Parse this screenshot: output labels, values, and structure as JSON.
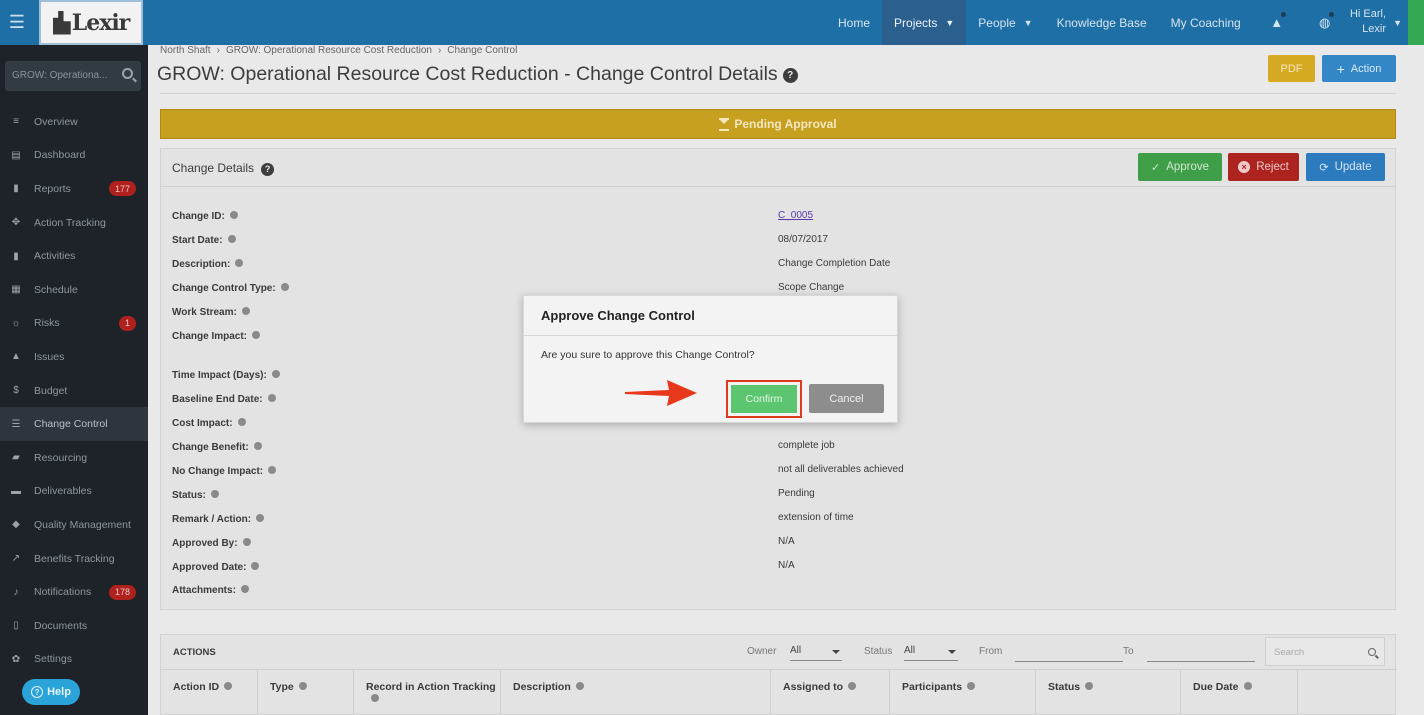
{
  "topbar": {
    "logo_text": "Lexir",
    "nav": [
      {
        "label": "Home"
      },
      {
        "label": "Projects",
        "dropdown": true,
        "active": true
      },
      {
        "label": "People",
        "dropdown": true
      },
      {
        "label": "Knowledge Base"
      },
      {
        "label": "My Coaching"
      }
    ],
    "user_greeting_line1": "Hi Earl,",
    "user_greeting_line2": "Lexir",
    "colors": {
      "bar": "#1f6fa7",
      "active": "#2a5f8e"
    }
  },
  "sidebar": {
    "search_placeholder": "GROW: Operationa...",
    "items": [
      {
        "label": "Overview",
        "icon": "list-icon"
      },
      {
        "label": "Dashboard",
        "icon": "dashboard-icon"
      },
      {
        "label": "Reports",
        "icon": "bar-chart-icon",
        "badge": "177"
      },
      {
        "label": "Action Tracking",
        "icon": "arrows-icon"
      },
      {
        "label": "Activities",
        "icon": "bookmark-icon"
      },
      {
        "label": "Schedule",
        "icon": "calendar-icon"
      },
      {
        "label": "Risks",
        "icon": "lightbulb-icon",
        "badge": "1"
      },
      {
        "label": "Issues",
        "icon": "warning-icon"
      },
      {
        "label": "Budget",
        "icon": "dollar-icon"
      },
      {
        "label": "Change Control",
        "icon": "database-icon",
        "active": true
      },
      {
        "label": "Resourcing",
        "icon": "folder-icon"
      },
      {
        "label": "Deliverables",
        "icon": "truck-icon"
      },
      {
        "label": "Quality Management",
        "icon": "tag-icon"
      },
      {
        "label": "Benefits Tracking",
        "icon": "line-chart-icon"
      },
      {
        "label": "Notifications",
        "icon": "bell-icon",
        "badge": "178"
      },
      {
        "label": "Documents",
        "icon": "document-icon"
      },
      {
        "label": "Settings",
        "icon": "gear-icon"
      }
    ],
    "help_label": "Help"
  },
  "breadcrumb": [
    "North Shaft",
    "GROW: Operational Resource Cost Reduction",
    "Change Control"
  ],
  "page_title": "GROW: Operational Resource Cost Reduction - Change Control Details",
  "header_buttons": {
    "pdf": "PDF",
    "action": "Action"
  },
  "status_banner": "Pending Approval",
  "details_panel": {
    "title": "Change Details",
    "buttons": {
      "approve": "Approve",
      "reject": "Reject",
      "update": "Update"
    },
    "fields": [
      {
        "label": "Change ID:",
        "value": "C_0005",
        "link": true
      },
      {
        "label": "Start Date:",
        "value": "08/07/2017"
      },
      {
        "label": "Description:",
        "value": "Change Completion Date"
      },
      {
        "label": "Change Control Type:",
        "value": "Scope Change"
      },
      {
        "label": "Work Stream:",
        "value": ""
      },
      {
        "label": "Change Impact:",
        "value": ""
      },
      {
        "label": "Time Impact (Days):",
        "value": ""
      },
      {
        "label": "Baseline End Date:",
        "value": ""
      },
      {
        "label": "Cost Impact:",
        "value": ""
      },
      {
        "label": "Change Benefit:",
        "value": "complete job"
      },
      {
        "label": "No Change Impact:",
        "value": "not all deliverables achieved"
      },
      {
        "label": "Status:",
        "value": "Pending"
      },
      {
        "label": "Remark / Action:",
        "value": "extension of time"
      },
      {
        "label": "Approved By:",
        "value": "N/A"
      },
      {
        "label": "Approved Date:",
        "value": "N/A"
      },
      {
        "label": "Attachments:",
        "value": ""
      }
    ]
  },
  "actions_panel": {
    "title": "ACTIONS",
    "owner_label": "Owner",
    "owner_value": "All",
    "status_label": "Status",
    "status_value": "All",
    "from_label": "From",
    "to_label": "To",
    "search_placeholder": "Search",
    "columns": [
      "Action ID",
      "Type",
      "Record in Action Tracking",
      "Description",
      "Assigned to",
      "Participants",
      "Status",
      "Due Date"
    ]
  },
  "modal": {
    "title": "Approve Change Control",
    "message": "Are you sure to approve this Change Control?",
    "confirm_label": "Confirm",
    "cancel_label": "Cancel"
  }
}
